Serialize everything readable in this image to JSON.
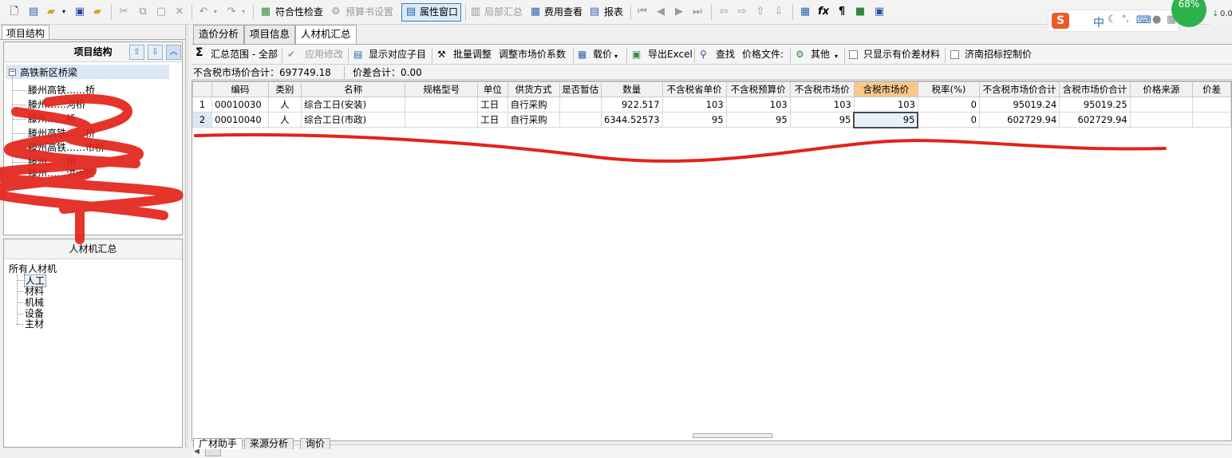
{
  "toolbar": {
    "items": [
      {
        "icon": "new-file-icon",
        "label": ""
      },
      {
        "icon": "new-project-icon",
        "label": ""
      },
      {
        "icon": "open-folder-icon",
        "label": ""
      },
      {
        "icon": "save-icon",
        "label": ""
      },
      {
        "icon": "save-as-icon",
        "label": ""
      },
      {
        "icon": "cut-icon",
        "label": ""
      },
      {
        "icon": "copy-icon",
        "label": ""
      },
      {
        "icon": "paste-icon",
        "label": ""
      },
      {
        "icon": "delete-icon",
        "label": ""
      },
      {
        "icon": "undo-icon",
        "label": ""
      },
      {
        "icon": "redo-icon",
        "label": ""
      }
    ],
    "compliance_check": "符合性检查",
    "budget_settings": "预算书设置",
    "property_window": "属性窗口",
    "partial_summary": "局部汇总",
    "fee_view": "费用查看",
    "report": "报表"
  },
  "left_panel": {
    "tab": "项目结构",
    "structure_title": "项目结构",
    "root_node": "高铁新区桥梁",
    "children": [
      {
        "label": "滕州高铁……桥"
      },
      {
        "label": "滕州……河桥"
      },
      {
        "label": "滕州……桥"
      },
      {
        "label": "滕州高铁……桥"
      },
      {
        "label": "滕州高铁……市桥"
      },
      {
        "label": "滕州……桥"
      },
      {
        "label": "滕州……洪河桥"
      }
    ],
    "summary_title": "人材机汇总",
    "summary_root": "所有人材机",
    "summary_items": [
      "人工",
      "材料",
      "机械",
      "设备",
      "主材"
    ]
  },
  "main": {
    "tabs": [
      "造价分析",
      "项目信息",
      "人材机汇总"
    ],
    "subtoolbar": {
      "scope": "汇总范围 - 全部",
      "apply_edit": "应用修改",
      "show_sub": "显示对应子目",
      "batch_adjust": "批量调整",
      "adjust_factor": "调整市场价系数",
      "load_price": "载价",
      "export_excel": "导出Excel",
      "find": "查找",
      "price_file": "价格文件:",
      "other": "其他",
      "only_diff": "只显示有价差材料",
      "jinan": "济南招标控制价"
    },
    "summary": {
      "market_total_label": "不含税市场价合计：697749.18",
      "diff_total_label": "价差合计：0.00"
    },
    "columns": [
      "",
      "编码",
      "类别",
      "名称",
      "规格型号",
      "单位",
      "供货方式",
      "是否暂估",
      "数量",
      "不含税省单价",
      "不含税预算价",
      "不含税市场价",
      "含税市场价",
      "税率(%)",
      "不含税市场价合计",
      "含税市场价合计",
      "价格来源",
      "价差"
    ],
    "rows": [
      [
        "1",
        "00010030",
        "人",
        "综合工日(安装)",
        "",
        "工日",
        "自行采购",
        "",
        "922.517",
        "103",
        "103",
        "103",
        "103",
        "0",
        "95019.24",
        "95019.25",
        "",
        ""
      ],
      [
        "2",
        "00010040",
        "人",
        "综合工日(市政)",
        "",
        "工日",
        "自行采购",
        "",
        "6344.52573",
        "95",
        "95",
        "95",
        "95",
        "0",
        "602729.94",
        "602729.94",
        "",
        ""
      ]
    ],
    "bottom_tabs": [
      "广材助手",
      "来源分析",
      "询价"
    ]
  },
  "tray": {
    "ime_brand": "S",
    "ime_mode": "中",
    "progress_label": "68%",
    "progress_value": 68,
    "net_value": "0.0"
  }
}
